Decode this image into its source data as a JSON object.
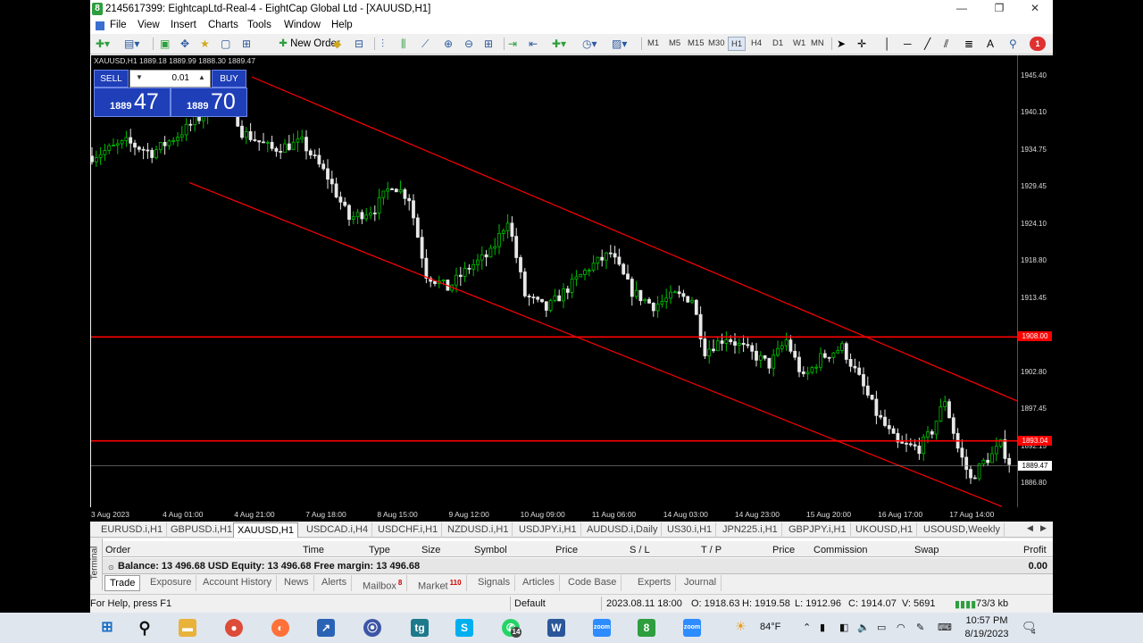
{
  "window": {
    "title": "2145617399: EightcapLtd-Real-4 - EightCap Global Ltd - [XAUUSD,H1]",
    "app_icon": "8",
    "minimize": "—",
    "restore": "❐",
    "close": "✕"
  },
  "menu": [
    "File",
    "View",
    "Insert",
    "Charts",
    "Tools",
    "Window",
    "Help"
  ],
  "toolbar": {
    "new_order_label": "New Order",
    "timeframes": [
      "M1",
      "M5",
      "M15",
      "M30",
      "H1",
      "H4",
      "D1",
      "W1",
      "MN"
    ],
    "active_timeframe": "H1",
    "notification_count": "1"
  },
  "chart": {
    "ohlc_header": "XAUUSD,H1  1889.18 1889.99 1888.30 1889.47",
    "trade_panel": {
      "sell_label": "SELL",
      "buy_label": "BUY",
      "lot": "0.01",
      "sell_prefix": "1889",
      "sell_big": "47",
      "buy_prefix": "1889",
      "buy_big": "70"
    },
    "price_tags": [
      {
        "text": "1908.00",
        "color": "#ff0000",
        "price": 1908.0
      },
      {
        "text": "1893.04",
        "color": "#ff0000",
        "price": 1893.04
      },
      {
        "text": "1889.47",
        "color": "#ffffff",
        "price": 1889.47
      }
    ],
    "colors": {
      "bullish": "#00c000",
      "bearish": "#e8e8e8",
      "channel": "#ff0000",
      "background": "#000000"
    }
  },
  "chart_data": {
    "type": "candlestick",
    "symbol": "XAUUSD",
    "timeframe": "H1",
    "y_ticks": [
      "1945.40",
      "1940.10",
      "1934.75",
      "1929.45",
      "1924.10",
      "1918.80",
      "1913.45",
      "1908.10",
      "1902.80",
      "1897.45",
      "1892.15",
      "1886.80"
    ],
    "ylim": [
      1883.5,
      1948.5
    ],
    "x_ticks": [
      "3 Aug 2023",
      "4 Aug 01:00",
      "4 Aug 21:00",
      "7 Aug 18:00",
      "8 Aug 15:00",
      "9 Aug 12:00",
      "10 Aug 09:00",
      "11 Aug 06:00",
      "14 Aug 03:00",
      "14 Aug 23:00",
      "15 Aug 20:00",
      "16 Aug 17:00",
      "17 Aug 14:00"
    ],
    "close_path": [
      [
        0,
        1934.0
      ],
      [
        8,
        1936.0
      ],
      [
        14,
        1934.5
      ],
      [
        20,
        1937.0
      ],
      [
        26,
        1940.0
      ],
      [
        30,
        1945.5
      ],
      [
        35,
        1937.5
      ],
      [
        42,
        1935.0
      ],
      [
        49,
        1936.0
      ],
      [
        55,
        1931.0
      ],
      [
        60,
        1925.0
      ],
      [
        66,
        1926.5
      ],
      [
        70,
        1930.0
      ],
      [
        74,
        1928.0
      ],
      [
        78,
        1917.0
      ],
      [
        83,
        1915.0
      ],
      [
        88,
        1918.0
      ],
      [
        93,
        1920.0
      ],
      [
        97,
        1925.0
      ],
      [
        101,
        1914.0
      ],
      [
        106,
        1912.0
      ],
      [
        111,
        1915.0
      ],
      [
        116,
        1918.0
      ],
      [
        121,
        1920.0
      ],
      [
        126,
        1914.5
      ],
      [
        131,
        1912.5
      ],
      [
        136,
        1914.0
      ],
      [
        140,
        1913.5
      ],
      [
        143,
        1906.0
      ],
      [
        148,
        1908.0
      ],
      [
        153,
        1906.0
      ],
      [
        158,
        1904.0
      ],
      [
        162,
        1907.5
      ],
      [
        166,
        1902.0
      ],
      [
        170,
        1905.0
      ],
      [
        175,
        1906.5
      ],
      [
        179,
        1902.0
      ],
      [
        183,
        1897.0
      ],
      [
        188,
        1892.5
      ],
      [
        193,
        1892.0
      ],
      [
        196,
        1894.5
      ],
      [
        199,
        1899.0
      ],
      [
        202,
        1892.0
      ],
      [
        205,
        1887.5
      ],
      [
        208,
        1890.0
      ],
      [
        210,
        1891.0
      ],
      [
        212,
        1892.5
      ],
      [
        214,
        1890.0
      ]
    ],
    "channel_upper": [
      [
        1945.4,
        1944.4
      ],
      [
        1903.5,
        1898.8
      ]
    ],
    "channel_lower": [
      [
        1930.2,
        1929.5
      ],
      [
        1884.0,
        1883.6
      ]
    ],
    "horizontal_lines": [
      1908.0,
      1893.04
    ],
    "current_price": 1889.47
  },
  "chart_tabs": [
    "EURUSD.i,H1",
    "GBPUSD.i,H1",
    "XAUUSD,H1",
    "USDCAD.i,H4",
    "USDCHF.i,H1",
    "NZDUSD.i,H1",
    "USDJPY.i,H1",
    "AUDUSD.i,Daily",
    "US30.i,H1",
    "JPN225.i,H1",
    "GBPJPY.i,H1",
    "UKOUSD,H1",
    "USOUSD,Weekly"
  ],
  "active_chart_tab": "XAUUSD,H1",
  "terminal": {
    "side_label": "Terminal",
    "headers": {
      "order": "Order",
      "time": "Time",
      "type": "Type",
      "size": "Size",
      "symbol": "Symbol",
      "price": "Price",
      "sl": "S / L",
      "tp": "T / P",
      "price2": "Price",
      "commission": "Commission",
      "swap": "Swap",
      "profit": "Profit"
    },
    "balance_line": "Balance: 13 496.68 USD  Equity: 13 496.68  Free margin: 13 496.68",
    "profit_total": "0.00",
    "tabs": [
      {
        "label": "Trade",
        "badge": ""
      },
      {
        "label": "Exposure",
        "badge": ""
      },
      {
        "label": "Account History",
        "badge": ""
      },
      {
        "label": "News",
        "badge": ""
      },
      {
        "label": "Alerts",
        "badge": ""
      },
      {
        "label": "Mailbox",
        "badge": "8"
      },
      {
        "label": "Market",
        "badge": "110"
      },
      {
        "label": "Signals",
        "badge": ""
      },
      {
        "label": "Articles",
        "badge": ""
      },
      {
        "label": "Code Base",
        "badge": ""
      },
      {
        "label": "Experts",
        "badge": ""
      },
      {
        "label": "Journal",
        "badge": ""
      }
    ],
    "active_tab": "Trade"
  },
  "status": {
    "help": "For Help, press F1",
    "profile": "Default",
    "datetime": "2023.08.11 18:00",
    "open": "O: 1918.63",
    "high": "H: 1919.58",
    "low": "L: 1912.96",
    "close": "C: 1914.07",
    "volume": "V: 5691",
    "traffic": "73/3 kb"
  },
  "taskbar": {
    "weather": "84°F",
    "time": "10:57 PM",
    "date": "8/19/2023",
    "whatsapp_badge": "14",
    "notif_badge": "4"
  }
}
